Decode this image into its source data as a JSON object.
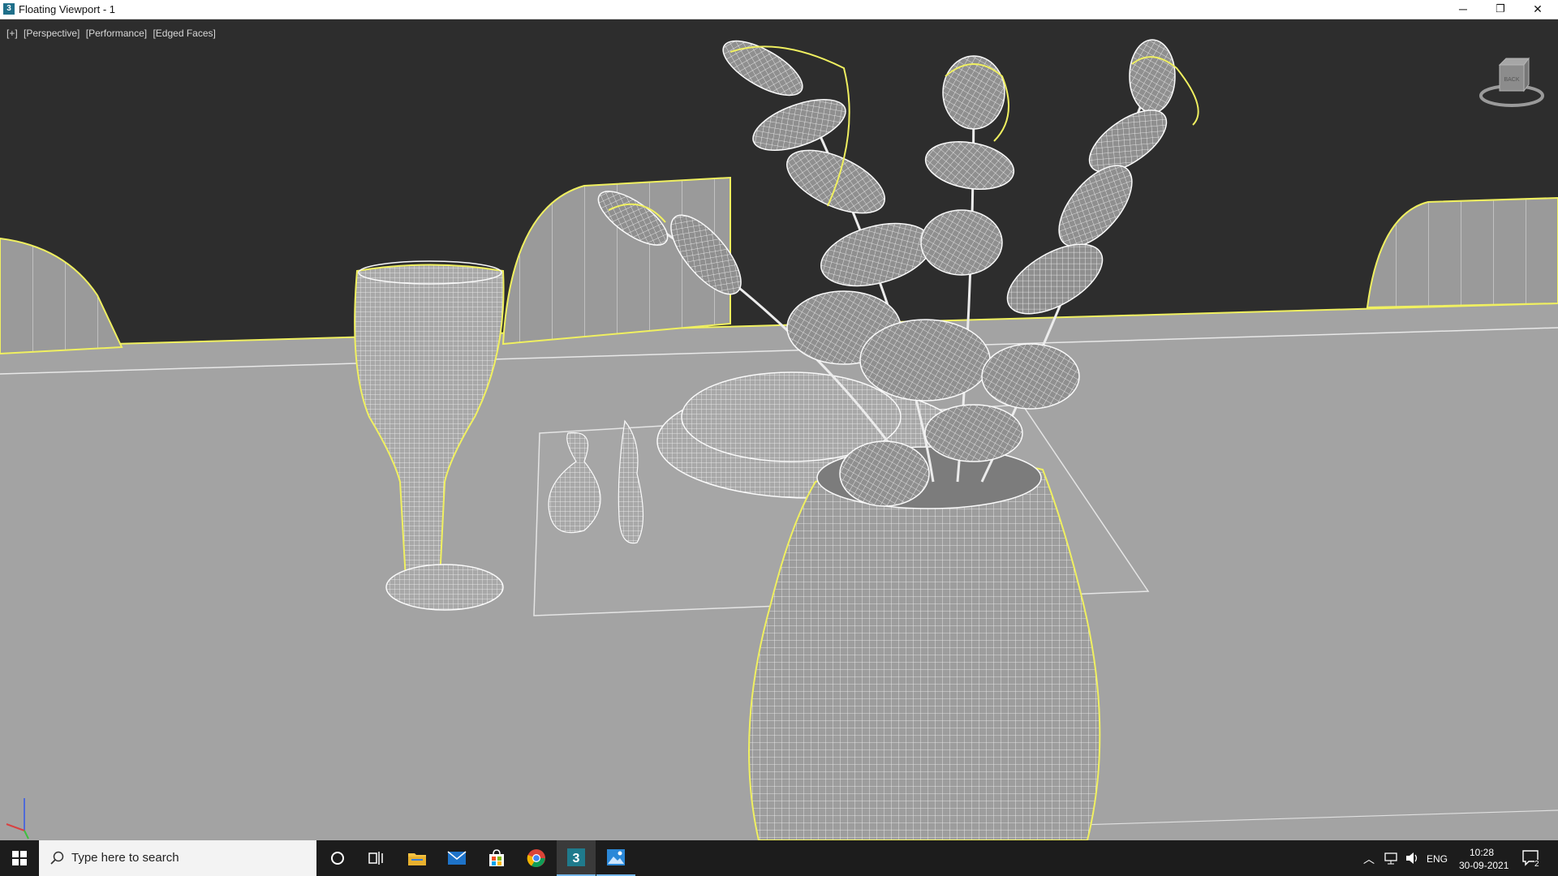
{
  "window": {
    "title": "Floating Viewport - 1",
    "app_icon_glyph": "3",
    "buttons": {
      "minimize": "─",
      "restore": "❐",
      "close": "✕"
    }
  },
  "viewport": {
    "labels": [
      "[+]",
      "[Perspective]",
      "[Performance]",
      "[Edged Faces]"
    ],
    "background_color": "#2d2d2d",
    "selection_color": "#f0f060",
    "viewcube_label": "BACK"
  },
  "taskbar": {
    "search_placeholder": "Type here to search",
    "apps": [
      "windows-start-icon",
      "cortana-icon",
      "task-view-icon",
      "file-explorer-icon",
      "mail-icon",
      "store-icon",
      "chrome-icon",
      "3dsmax-icon",
      "photos-icon"
    ],
    "tray": {
      "language": "ENG",
      "time": "10:28",
      "date": "30-09-2021",
      "notification_count": "2"
    }
  }
}
